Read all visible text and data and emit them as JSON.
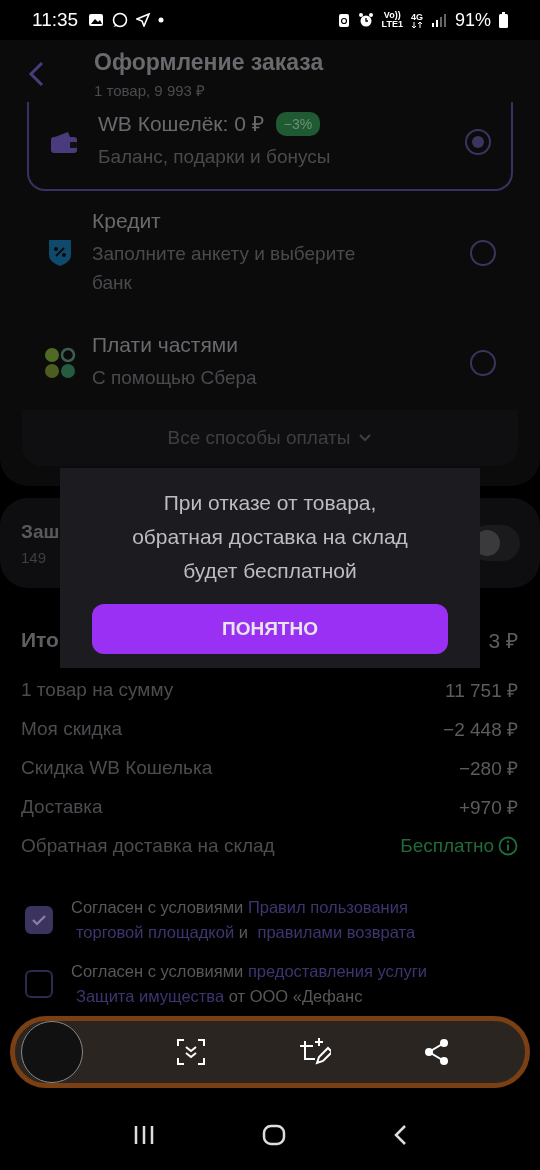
{
  "status_bar": {
    "time": "11:35",
    "network_labels": [
      "Vo))",
      "LTE1"
    ],
    "data_label": "4G",
    "battery": "91%"
  },
  "header": {
    "title": "Оформление заказа",
    "subtitle": "1 товар, 9 993 ₽"
  },
  "payment_methods": [
    {
      "kind": "wallet",
      "title": "WB Кошелёк: 0 ₽",
      "badge": "−3%",
      "subtitle": "Баланс, подарки и бонусы",
      "selected": true
    },
    {
      "kind": "credit",
      "title": "Кредит",
      "subtitle": "Заполните анкету и выберите банк",
      "selected": false
    },
    {
      "kind": "installments",
      "title": "Плати частями",
      "subtitle": "С помощью Сбера",
      "selected": false
    }
  ],
  "all_methods_link": "Все способы оплаты",
  "protection": {
    "title": "Заш",
    "price": "149",
    "on": false
  },
  "summary": {
    "title": "Ито",
    "total": "3 ₽",
    "rows": [
      {
        "kind": "plain",
        "label": "1 товар на сумму",
        "value": "11 751 ₽"
      },
      {
        "kind": "plain",
        "label": "Моя скидка",
        "value": "−2 448 ₽"
      },
      {
        "kind": "plain",
        "label": "Скидка WB Кошелька",
        "value": "−280 ₽"
      },
      {
        "kind": "plain",
        "label": "Доставка",
        "value": "+970 ₽"
      },
      {
        "kind": "free",
        "label": "Обратная доставка на склад",
        "value": "Бесплатно"
      }
    ]
  },
  "agreements": [
    {
      "checked": true,
      "segments": [
        {
          "kind": "text",
          "text": "Согласен с условиями "
        },
        {
          "kind": "link",
          "text": "Правил пользования"
        },
        {
          "kind": "link",
          "text": "торговой площадкой"
        },
        {
          "kind": "text",
          "text": " и "
        },
        {
          "kind": "link",
          "text": "правилами возврата"
        }
      ]
    },
    {
      "checked": false,
      "segments": [
        {
          "kind": "text",
          "text": "Согласен с условиями "
        },
        {
          "kind": "link",
          "text": "предоставления услуги"
        },
        {
          "kind": "link",
          "text": "Защита имущества"
        },
        {
          "kind": "text",
          "text": " от ООО «Дефанс"
        }
      ]
    }
  ],
  "popup": {
    "message": "При отказе от товара, обратная доставка на склад будет бесплатной",
    "button": "ПОНЯТНО"
  }
}
